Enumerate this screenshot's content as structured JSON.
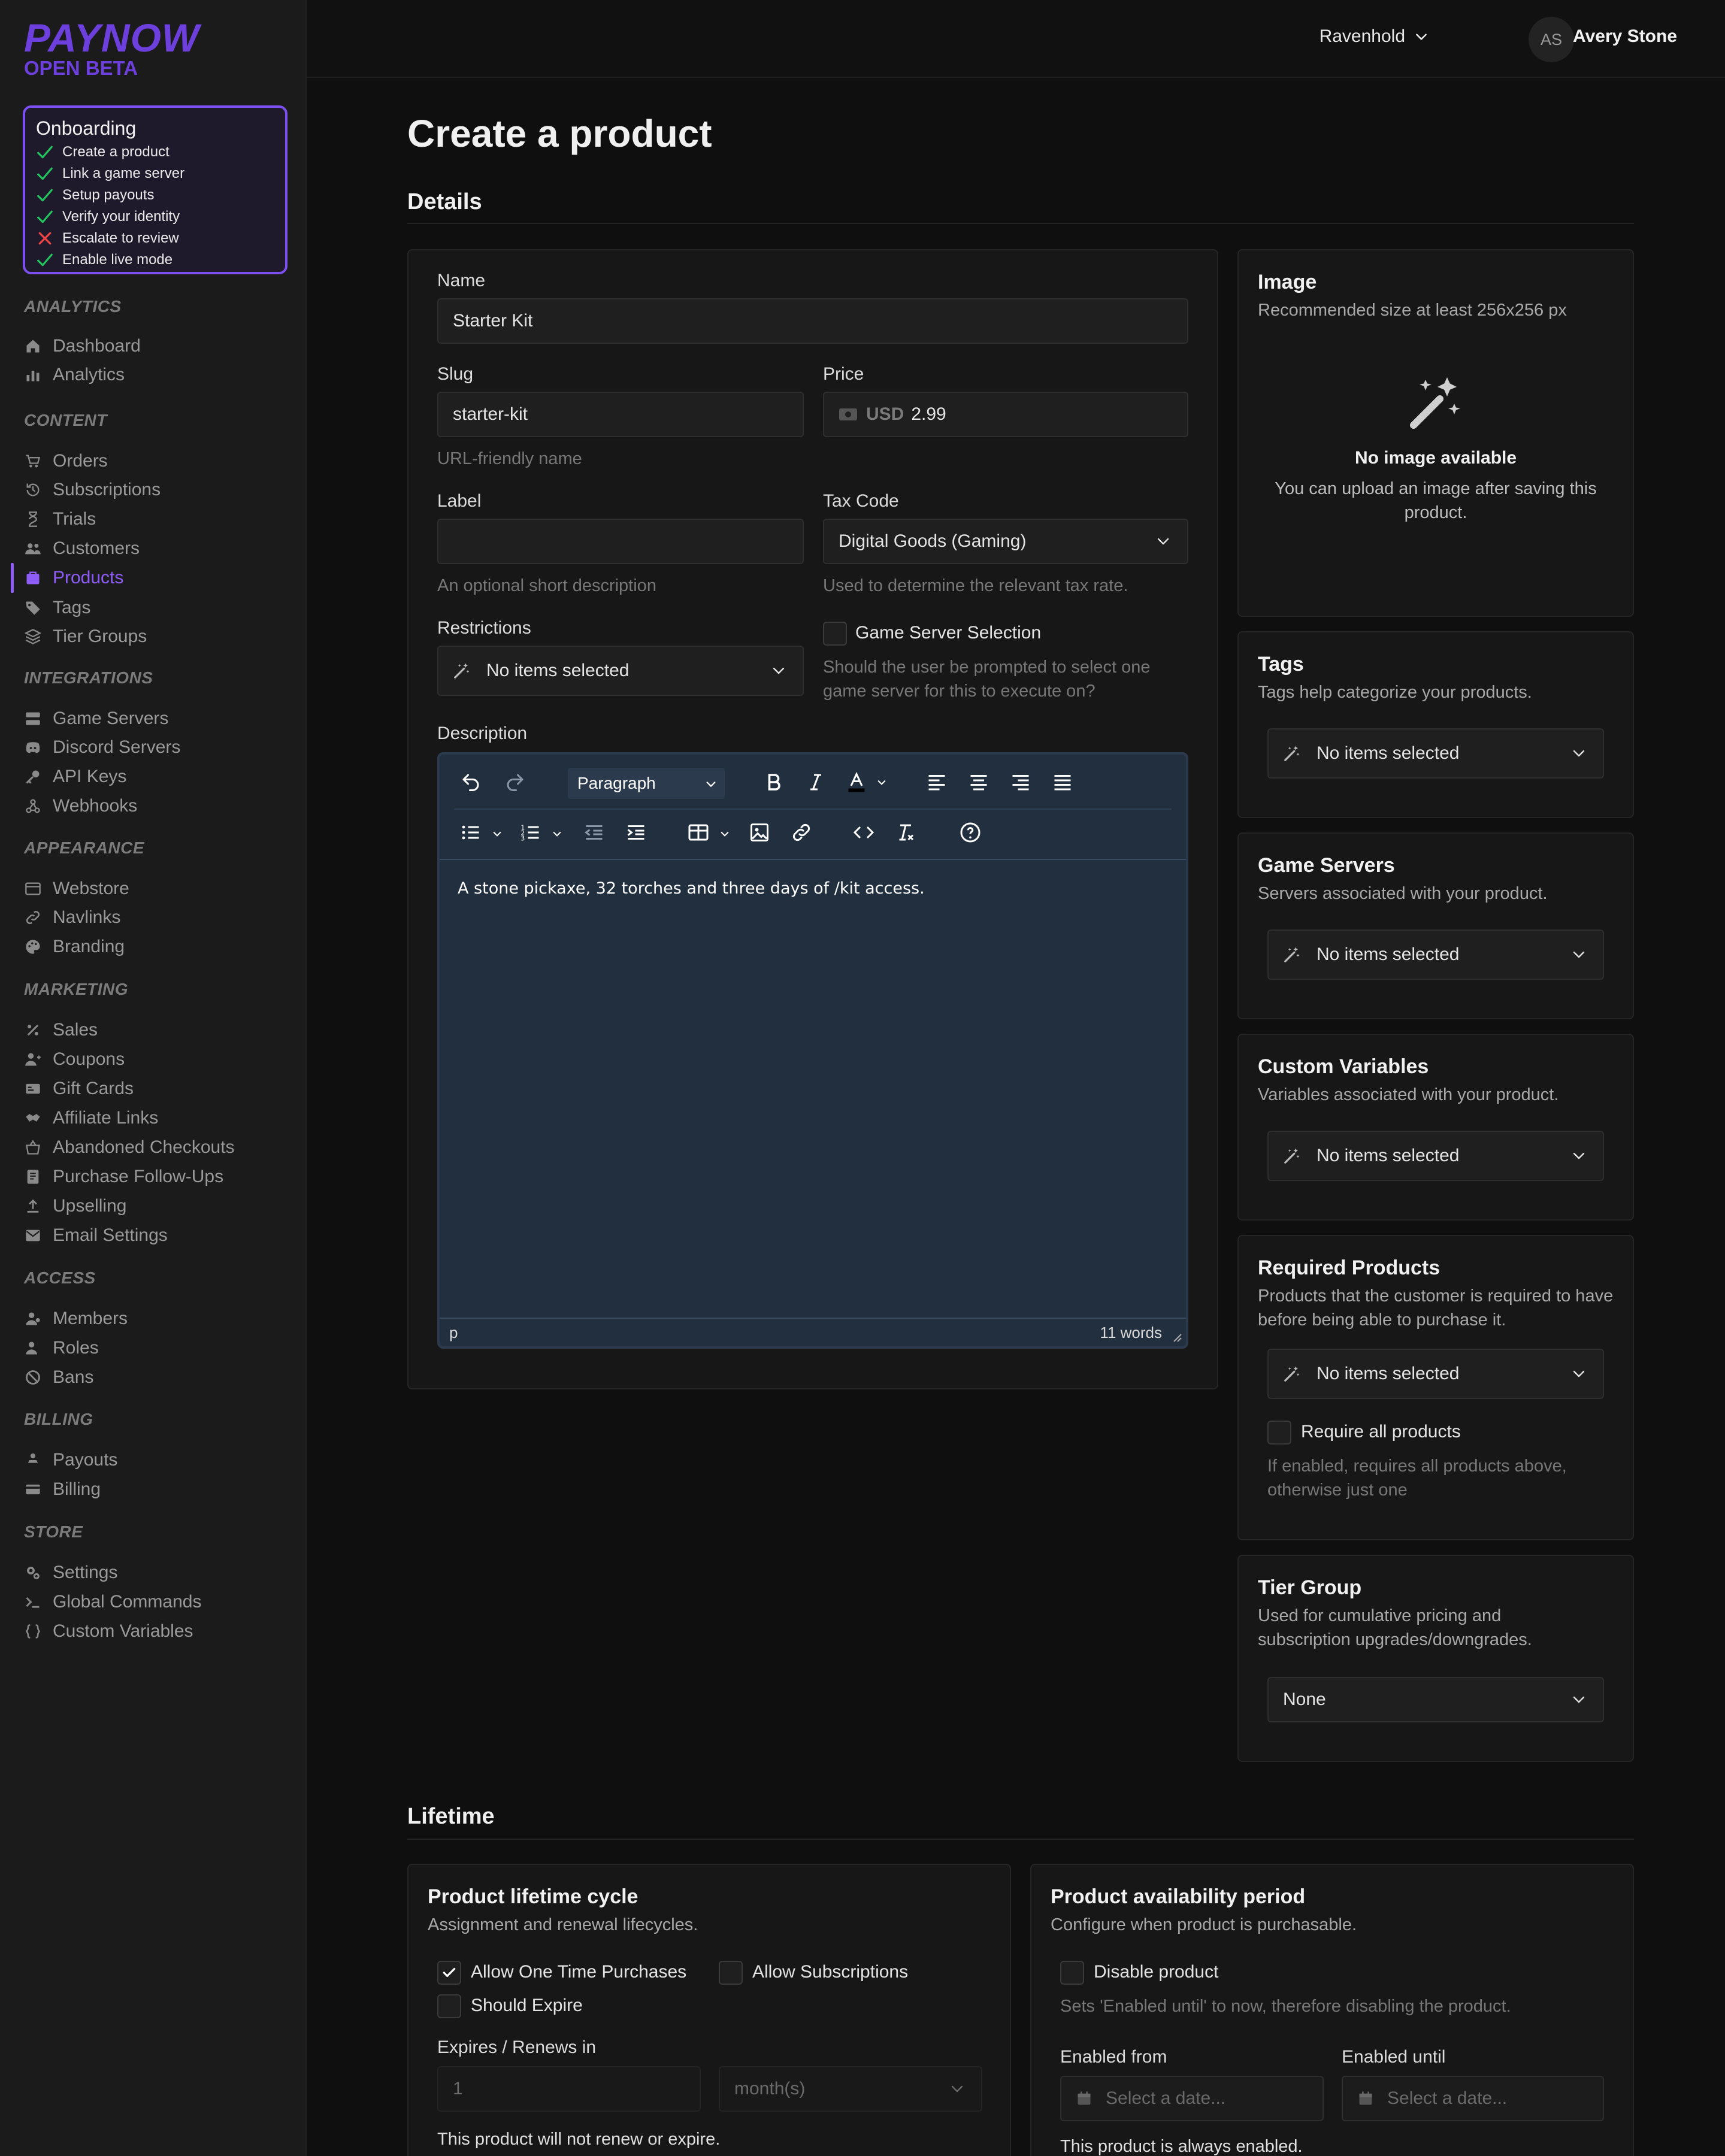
{
  "brand": {
    "name": "PAYNOW",
    "tag": "OPEN BETA",
    "accent": "#6d3fdc"
  },
  "onboarding": {
    "title": "Onboarding",
    "items": [
      {
        "label": "Create a product",
        "done": true
      },
      {
        "label": "Link a game server",
        "done": true
      },
      {
        "label": "Setup payouts",
        "done": true
      },
      {
        "label": "Verify your identity",
        "done": true
      },
      {
        "label": "Escalate to review",
        "done": false
      },
      {
        "label": "Enable live mode",
        "done": true
      }
    ]
  },
  "nav": {
    "analytics": {
      "title": "ANALYTICS",
      "items": [
        "Dashboard",
        "Analytics"
      ]
    },
    "content": {
      "title": "CONTENT",
      "items": [
        "Orders",
        "Subscriptions",
        "Trials",
        "Customers",
        "Products",
        "Tags",
        "Tier Groups"
      ]
    },
    "integrations": {
      "title": "INTEGRATIONS",
      "items": [
        "Game Servers",
        "Discord Servers",
        "API Keys",
        "Webhooks"
      ]
    },
    "appearance": {
      "title": "APPEARANCE",
      "items": [
        "Webstore",
        "Navlinks",
        "Branding"
      ]
    },
    "marketing": {
      "title": "MARKETING",
      "items": [
        "Sales",
        "Coupons",
        "Gift Cards",
        "Affiliate Links",
        "Abandoned Checkouts",
        "Purchase Follow-Ups",
        "Upselling",
        "Email Settings"
      ]
    },
    "access": {
      "title": "ACCESS",
      "items": [
        "Members",
        "Roles",
        "Bans"
      ]
    },
    "billing": {
      "title": "BILLING",
      "items": [
        "Payouts",
        "Billing"
      ]
    },
    "store": {
      "title": "STORE",
      "items": [
        "Settings",
        "Global Commands",
        "Custom Variables"
      ]
    },
    "active": "Products"
  },
  "topbar": {
    "team": "Ravenhold",
    "avatar_initials": "AS",
    "user": "Avery Stone"
  },
  "page": {
    "title": "Create a product",
    "details_heading": "Details",
    "lifetime_heading": "Lifetime"
  },
  "form": {
    "name_label": "Name",
    "name_value": "Starter Kit",
    "slug_label": "Slug",
    "slug_value": "starter-kit",
    "slug_hint": "URL-friendly name",
    "price_label": "Price",
    "price_currency": "USD",
    "price_value": "2.99",
    "label_label": "Label",
    "label_value": "",
    "label_hint": "An optional short description",
    "tax_label": "Tax Code",
    "tax_value": "Digital Goods (Gaming)",
    "tax_hint": "Used to determine the relevant tax rate.",
    "restrictions_label": "Restrictions",
    "restrictions_value": "No items selected",
    "gss_label": "Game Server Selection",
    "gss_hint": "Should the user be prompted to select one game server for this to execute on?",
    "description_label": "Description"
  },
  "editor": {
    "block_format": "Paragraph",
    "content": "A stone pickaxe, 32 torches and three days of /kit access.",
    "status_path": "p",
    "word_count": "11 words"
  },
  "image_card": {
    "title": "Image",
    "subtitle": "Recommended size at least 256x256 px",
    "empty_title": "No image available",
    "empty_text": "You can upload an image after saving this product."
  },
  "tags_card": {
    "title": "Tags",
    "subtitle": "Tags help categorize your products.",
    "value": "No items selected"
  },
  "servers_card": {
    "title": "Game Servers",
    "subtitle": "Servers associated with your product.",
    "value": "No items selected"
  },
  "variables_card": {
    "title": "Custom Variables",
    "subtitle": "Variables associated with your product.",
    "value": "No items selected"
  },
  "required_card": {
    "title": "Required Products",
    "subtitle": "Products that the customer is required to have before being able to purchase it.",
    "value": "No items selected",
    "require_all_label": "Require all products",
    "require_all_hint": "If enabled, requires all products above, otherwise just one"
  },
  "tier_card": {
    "title": "Tier Group",
    "subtitle": "Used for cumulative pricing and subscription upgrades/downgrades.",
    "value": "None"
  },
  "lifecycle_card": {
    "title": "Product lifetime cycle",
    "subtitle": "Assignment and renewal lifecycles.",
    "one_time_label": "Allow One Time Purchases",
    "one_time_checked": true,
    "subs_label": "Allow Subscriptions",
    "subs_checked": false,
    "expire_label": "Should Expire",
    "expire_checked": false,
    "expires_label": "Expires / Renews in",
    "expires_value": "1",
    "expires_unit": "month(s)",
    "summary": "This product will not renew or expire."
  },
  "availability_card": {
    "title": "Product availability period",
    "subtitle": "Configure when product is purchasable.",
    "disable_label": "Disable product",
    "disable_hint": "Sets 'Enabled until' to now, therefore disabling the product.",
    "from_label": "Enabled from",
    "from_placeholder": "Select a date...",
    "until_label": "Enabled until",
    "until_placeholder": "Select a date...",
    "summary": "This product is always enabled."
  }
}
